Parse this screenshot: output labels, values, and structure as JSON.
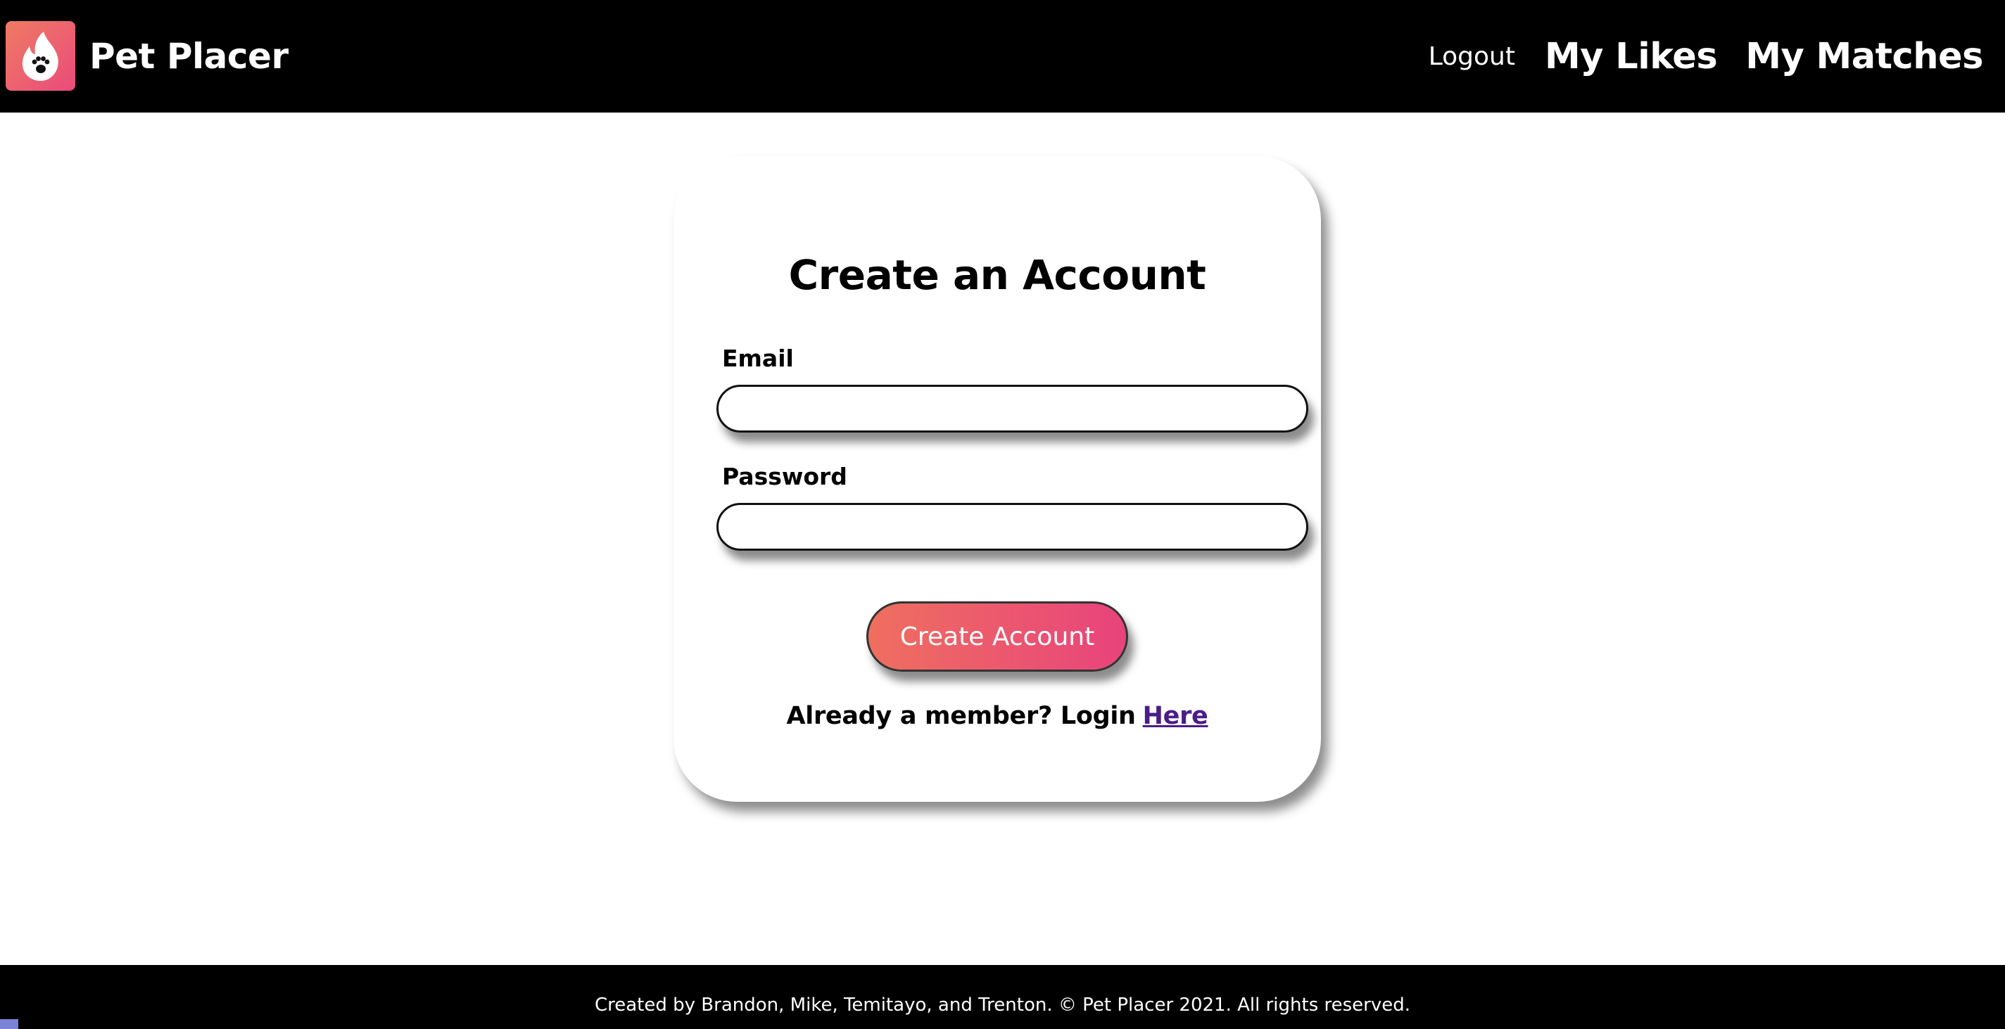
{
  "header": {
    "brand_name": "Pet Placer",
    "logo_icon": "flame-paw-icon",
    "nav": {
      "logout": "Logout",
      "likes": "My Likes",
      "matches": "My Matches"
    }
  },
  "form": {
    "title": "Create an Account",
    "email_label": "Email",
    "email_value": "",
    "password_label": "Password",
    "password_value": "",
    "submit_label": "Create Account",
    "login_prompt": "Already a member? Login",
    "login_link": "Here"
  },
  "footer": {
    "text": "Created by Brandon, Mike, Temitayo, and Trenton. © Pet Placer 2021. All rights reserved."
  },
  "colors": {
    "header_bg": "#000000",
    "accent_start": "#ef6f5f",
    "accent_end": "#e8437c",
    "link": "#4b1d87"
  }
}
